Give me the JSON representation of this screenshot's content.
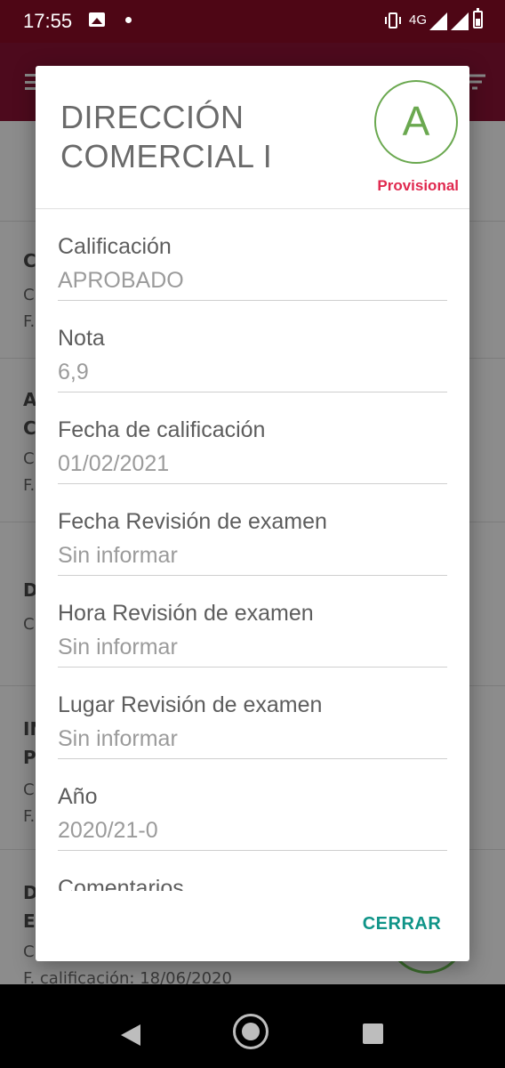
{
  "status_bar": {
    "time": "17:55",
    "network": "4G",
    "icons": [
      "image-icon",
      "notification-dot-icon",
      "vibrate-icon",
      "signal-icon",
      "signal-off-icon",
      "battery-icon"
    ]
  },
  "background_list": {
    "rows": [
      {
        "title": "C",
        "lines": [
          "C",
          "F."
        ]
      },
      {
        "title": "A\nC",
        "lines": [
          "C",
          "F."
        ]
      },
      {
        "title": "D",
        "lines": [
          "C"
        ]
      },
      {
        "title": "IN\nP",
        "lines": [
          "C",
          "F."
        ]
      },
      {
        "title": "D\nE",
        "lines": [
          "C",
          "F. calificación: 18/06/2020"
        ]
      }
    ]
  },
  "dialog": {
    "title": "DIRECCIÓN COMERCIAL I",
    "grade_letter": "A",
    "status": "Provisional",
    "fields": [
      {
        "label": "Calificación",
        "value": "APROBADO"
      },
      {
        "label": "Nota",
        "value": "6,9"
      },
      {
        "label": "Fecha de calificación",
        "value": "01/02/2021"
      },
      {
        "label": "Fecha Revisión de examen",
        "value": "Sin informar"
      },
      {
        "label": "Hora Revisión de examen",
        "value": "Sin informar"
      },
      {
        "label": "Lugar Revisión de examen",
        "value": "Sin informar"
      },
      {
        "label": "Año",
        "value": "2020/21-0"
      },
      {
        "label": "Comentarios",
        "value": ""
      }
    ],
    "close_label": "CERRAR"
  },
  "colors": {
    "app_bar": "#6d0d2a",
    "grade_green": "#6aa84f",
    "provisional_red": "#e0294f",
    "button_teal": "#0f9488"
  }
}
